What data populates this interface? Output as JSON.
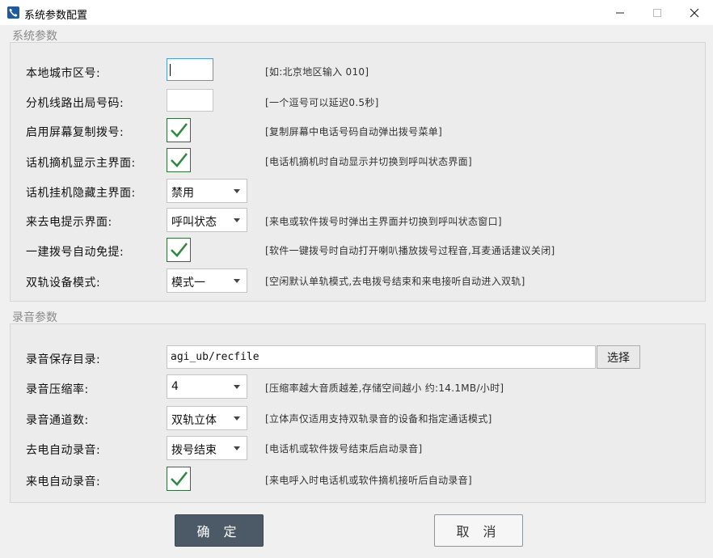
{
  "window": {
    "title": "系统参数配置",
    "icon": "phone-icon"
  },
  "system_group": {
    "title": "系统参数",
    "rows": {
      "area_code": {
        "label": "本地城市区号:",
        "value": "",
        "hint": "[如:北京地区输入 010]"
      },
      "extension_prefix": {
        "label": "分机线路出局号码:",
        "value": "",
        "hint": "[一个逗号可以延迟0.5秒]"
      },
      "screen_copy_dial": {
        "label": "启用屏幕复制拨号:",
        "checked": true,
        "hint": "[复制屏幕中电话号码自动弹出拨号菜单]"
      },
      "offhook_show": {
        "label": "话机摘机显示主界面:",
        "checked": true,
        "hint": "[电话机摘机时自动显示并切换到呼叫状态界面]"
      },
      "onhook_hide": {
        "label": "话机挂机隐藏主界面:",
        "selected": "禁用"
      },
      "call_prompt": {
        "label": "来去电提示界面:",
        "selected": "呼叫状态",
        "hint": "[来电或软件拨号时弹出主界面并切换到呼叫状态窗口]"
      },
      "one_key_handsfree": {
        "label": "一建拨号自动免提:",
        "checked": true,
        "hint": "[软件一键拨号时自动打开喇叭播放拨号过程音,耳麦通话建议关闭]"
      },
      "dual_track_mode": {
        "label": "双轨设备模式:",
        "selected": "模式一",
        "hint": "[空闲默认单轨模式,去电拨号结束和来电接听自动进入双轨]"
      }
    }
  },
  "record_group": {
    "title": "录音参数",
    "rows": {
      "save_dir": {
        "label": "录音保存目录:",
        "value": "agi_ub/recfile",
        "browse_label": "选择"
      },
      "compression": {
        "label": "录音压缩率:",
        "selected": "4",
        "hint": "[压缩率越大音质越差,存储空间越小 约:14.1MB/小时]"
      },
      "channels": {
        "label": "录音通道数:",
        "selected": "双轨立体",
        "hint": "[立体声仅适用支持双轨录音的设备和指定通话模式]"
      },
      "outgoing_record": {
        "label": "去电自动录音:",
        "selected": "拨号结束",
        "hint": "[电话机或软件拨号结束后启动录音]"
      },
      "incoming_record": {
        "label": "来电自动录音:",
        "checked": true,
        "hint": "[来电呼入时电话机或软件摘机接听后自动录音]"
      }
    }
  },
  "buttons": {
    "ok": "确 定",
    "cancel": "取 消"
  },
  "colors": {
    "ok_button_bg": "#4b5a66",
    "checkmark": "#2f8a3f",
    "focus_border": "#4a9ede"
  }
}
